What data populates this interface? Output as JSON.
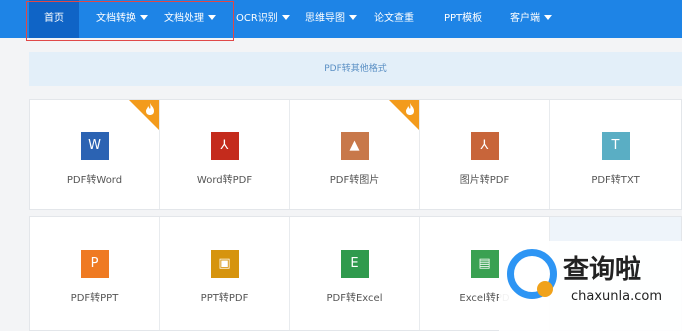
{
  "nav": {
    "items": [
      {
        "label": "首页",
        "dropdown": false,
        "active": true
      },
      {
        "label": "文档转换",
        "dropdown": true,
        "active": false
      },
      {
        "label": "文档处理",
        "dropdown": true,
        "active": false
      },
      {
        "label": "OCR识别",
        "dropdown": true,
        "active": false
      },
      {
        "label": "思维导图",
        "dropdown": true,
        "active": false
      },
      {
        "label": "论文查重",
        "dropdown": false,
        "active": false
      },
      {
        "label": "PPT模板",
        "dropdown": false,
        "active": false
      },
      {
        "label": "客户端",
        "dropdown": true,
        "active": false
      }
    ]
  },
  "banner": {
    "text": "PDF转其他格式"
  },
  "tools_row1": [
    {
      "label": "PDF转Word",
      "icon": "word-icon",
      "glyph": "W",
      "color": "#2b63b3",
      "hot": true
    },
    {
      "label": "Word转PDF",
      "icon": "pdf-icon",
      "glyph": "⅄",
      "color": "#c42b1c",
      "hot": false
    },
    {
      "label": "PDF转图片",
      "icon": "image-icon",
      "glyph": "▲",
      "color": "#c8784a",
      "hot": true
    },
    {
      "label": "图片转PDF",
      "icon": "pdf-icon",
      "glyph": "⅄",
      "color": "#c8653a",
      "hot": false
    },
    {
      "label": "PDF转TXT",
      "icon": "txt-icon",
      "glyph": "T",
      "color": "#5aaec4",
      "hot": false
    }
  ],
  "tools_row2": [
    {
      "label": "PDF转PPT",
      "icon": "ppt-icon",
      "glyph": "P",
      "color": "#ef7a22"
    },
    {
      "label": "PPT转PDF",
      "icon": "ppt-pdf-icon",
      "glyph": "▣",
      "color": "#d6940e"
    },
    {
      "label": "PDF转Excel",
      "icon": "excel-icon",
      "glyph": "E",
      "color": "#2f9a4d"
    },
    {
      "label": "Excel转PD",
      "icon": "excel-pdf-icon",
      "glyph": "▤",
      "color": "#3aa152"
    }
  ],
  "watermark": {
    "title": "查询啦",
    "url": "chaxunla.com"
  },
  "colors": {
    "nav": "#1e84e6",
    "nav_active": "#0f64c6",
    "hot_badge": "#f39b1c",
    "highlight": "#e04848"
  }
}
